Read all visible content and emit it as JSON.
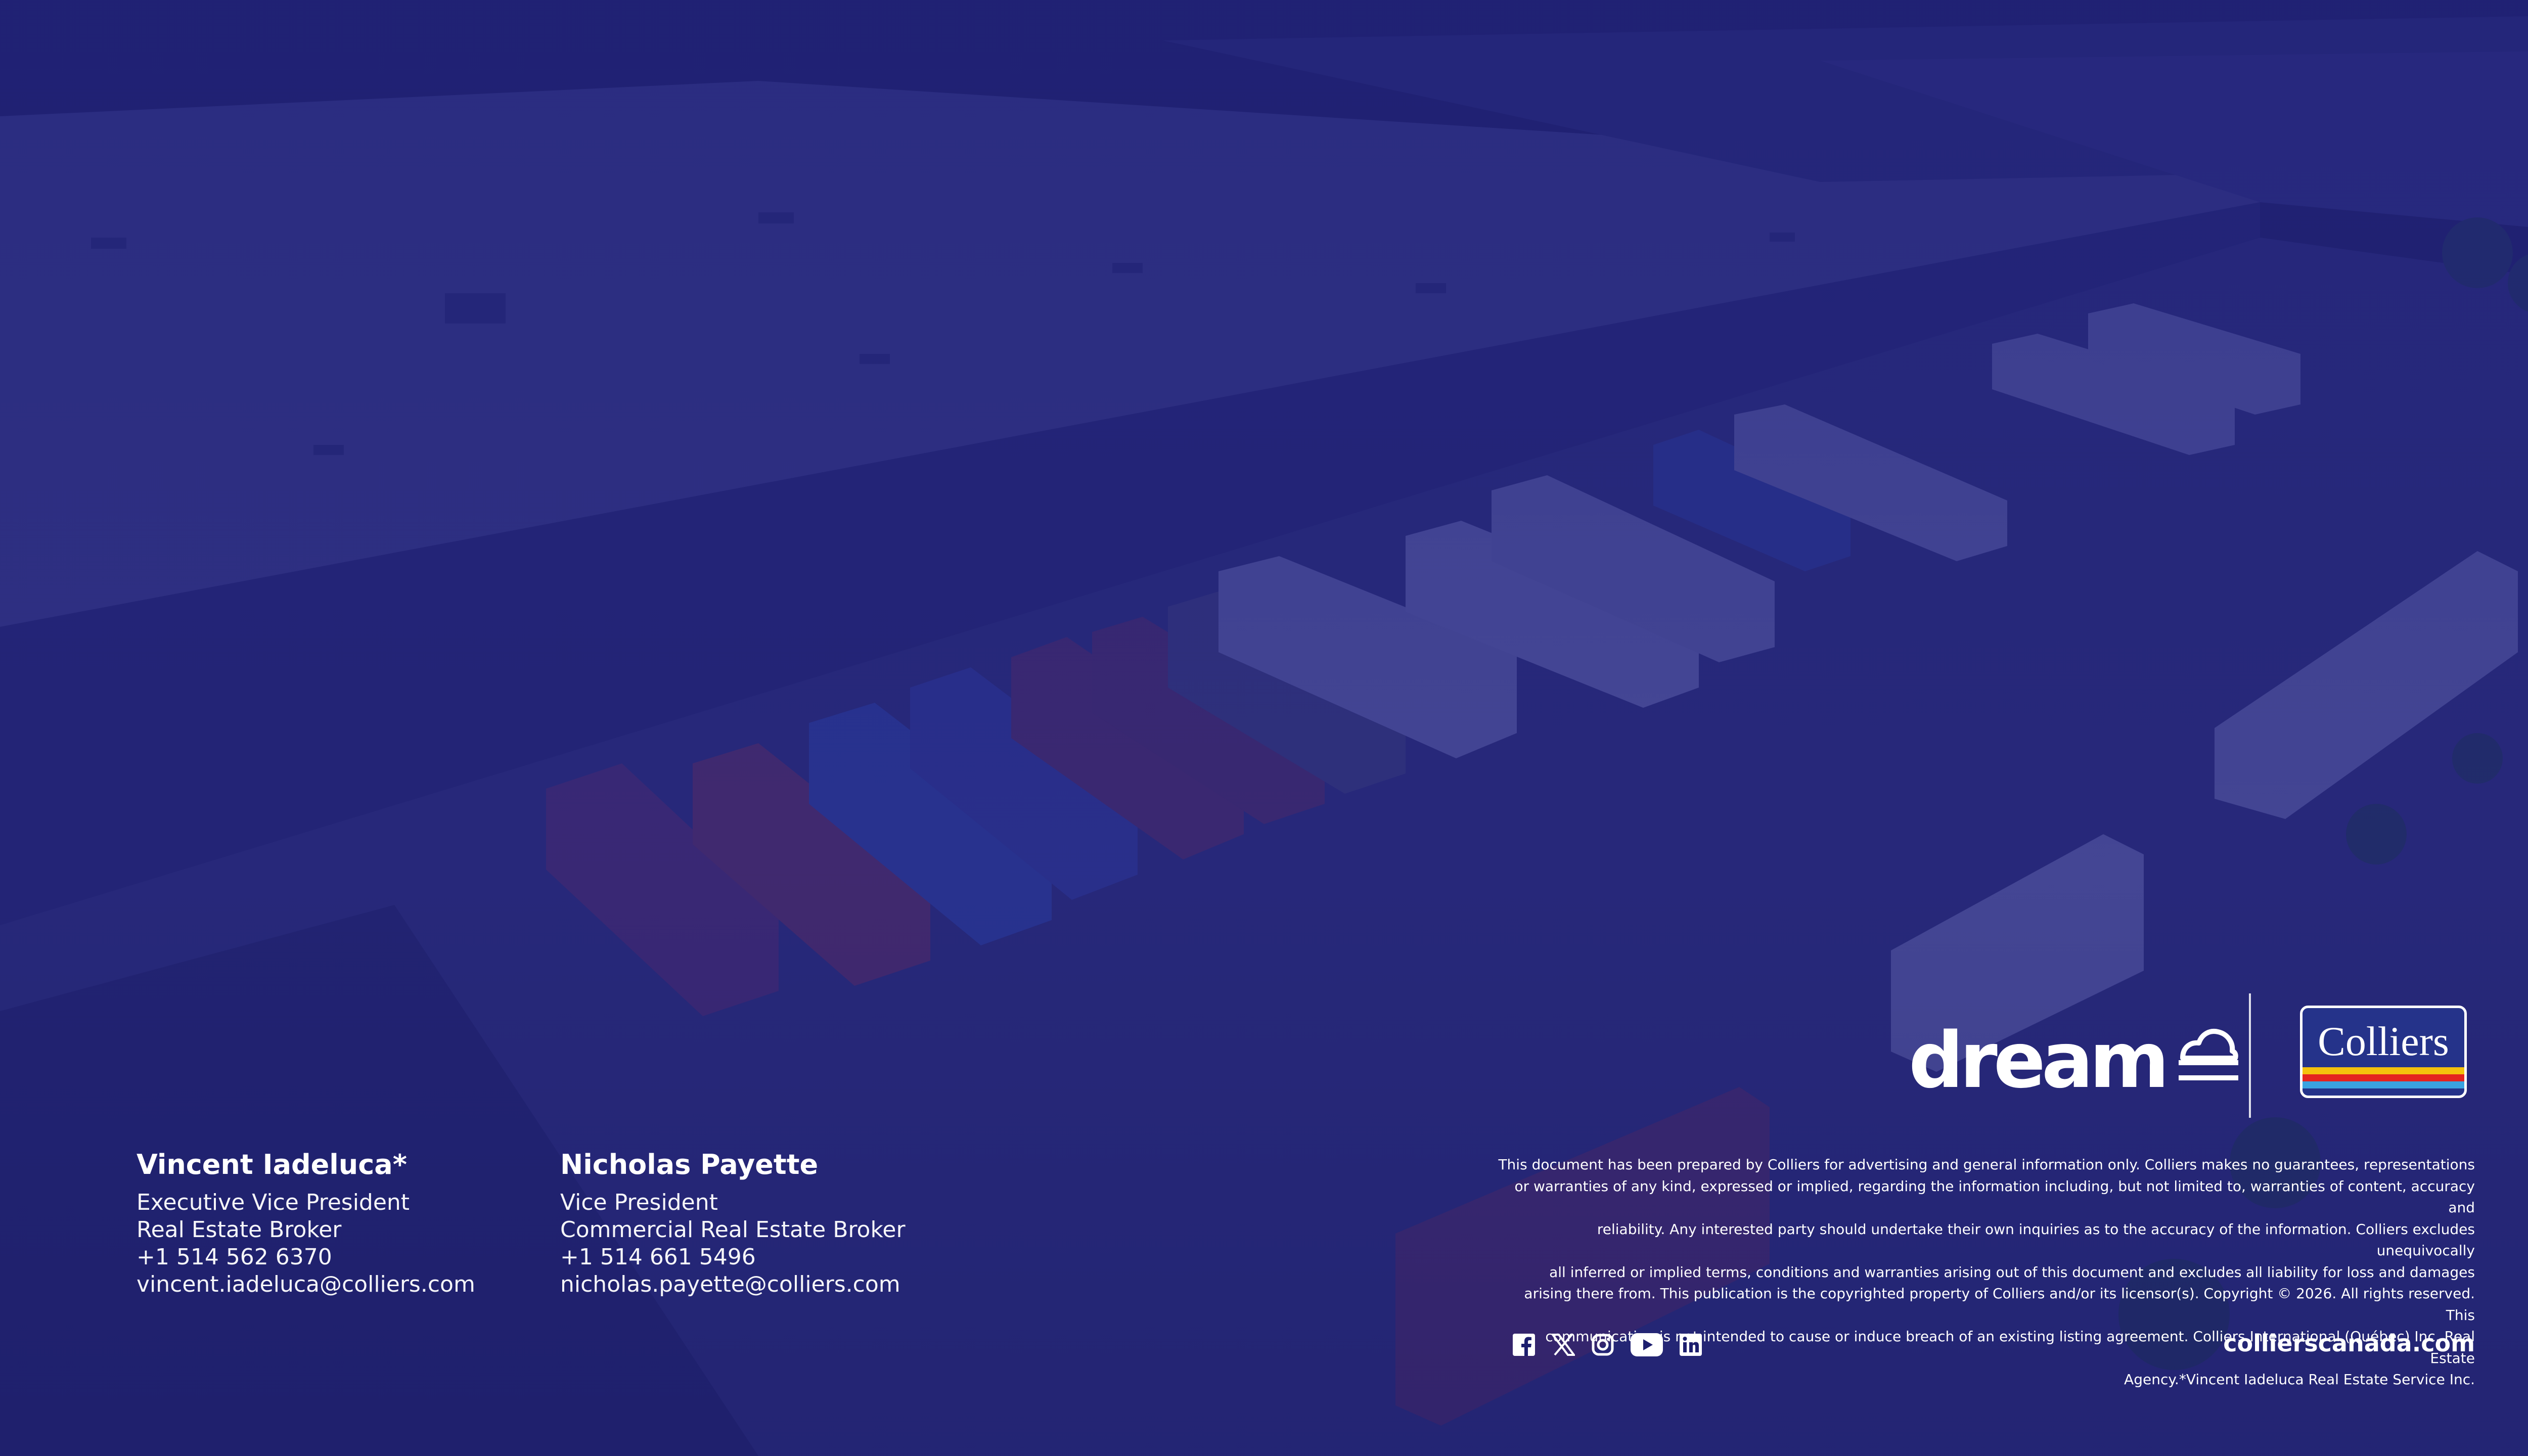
{
  "brand": {
    "dream_wordmark": "dream",
    "colliers_wordmark": "Colliers",
    "colliers_stripe_colors": [
      "#f4c20d",
      "#e4241f",
      "#3aa3e0"
    ]
  },
  "contacts": [
    {
      "name": "Vincent Iadeluca*",
      "title": "Executive Vice President",
      "role": "Real Estate Broker",
      "phone": "+1 514 562 6370",
      "email": "vincent.iadeluca@colliers.com"
    },
    {
      "name": "Nicholas Payette",
      "title": "Vice President",
      "role": "Commercial Real Estate Broker",
      "phone": "+1 514 661 5496",
      "email": "nicholas.payette@colliers.com"
    }
  ],
  "disclaimer": {
    "lines": [
      "This document has been prepared by Colliers for advertising and general information only. Colliers makes no guarantees, representations",
      "or warranties of any kind, expressed or implied, regarding the information including, but not limited to, warranties of content, accuracy and",
      "reliability. Any interested party should undertake their own inquiries as to the accuracy of the information. Colliers excludes unequivocally",
      "all inferred or implied terms, conditions and warranties arising out of this document and excludes all liability for loss and damages",
      "arising there from. This publication is the copyrighted property of Colliers and/or its licensor(s). Copyright © 2026. All rights reserved. This",
      "communication is not intended to cause or induce breach of an existing listing agreement. Colliers International (Québec) Inc. Real Estate",
      "Agency.*Vincent Iadeluca Real Estate Service Inc."
    ]
  },
  "social": [
    "facebook-icon",
    "x-icon",
    "instagram-icon",
    "youtube-icon",
    "linkedin-icon"
  ],
  "website": "collierscanada.com",
  "colors": {
    "overlay": "#1c1e6e",
    "text": "#ffffff",
    "colliers_blue": "#25338a"
  }
}
